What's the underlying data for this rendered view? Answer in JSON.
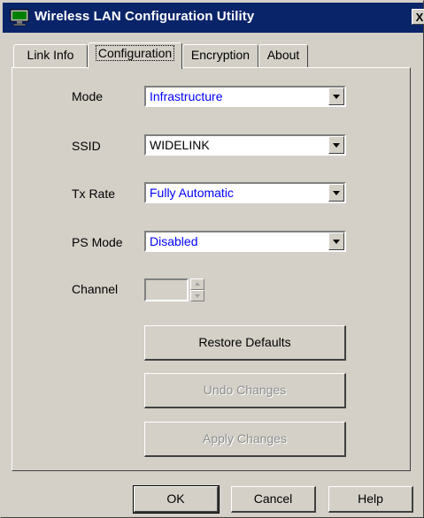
{
  "window": {
    "title": "Wireless LAN Configuration Utility",
    "close_symbol": "X",
    "icon": "monitor-icon"
  },
  "tabs": [
    {
      "label": "Link Info",
      "active": false
    },
    {
      "label": "Configuration",
      "active": true
    },
    {
      "label": "Encryption",
      "active": false
    },
    {
      "label": "About",
      "active": false
    }
  ],
  "config": {
    "mode": {
      "label": "Mode",
      "value": "Infrastructure"
    },
    "ssid": {
      "label": "SSID",
      "value": "WIDELINK"
    },
    "tx_rate": {
      "label": "Tx Rate",
      "value": "Fully Automatic"
    },
    "ps_mode": {
      "label": "PS Mode",
      "value": "Disabled"
    },
    "channel": {
      "label": "Channel",
      "value": ""
    },
    "restore_label": "Restore Defaults",
    "undo_label": "Undo Changes",
    "apply_label": "Apply Changes"
  },
  "footer": {
    "ok_label": "OK",
    "cancel_label": "Cancel",
    "help_label": "Help"
  },
  "colors": {
    "titlebar": "#0a246a",
    "face": "#d4d0c8",
    "value_blue": "#0000ff"
  }
}
